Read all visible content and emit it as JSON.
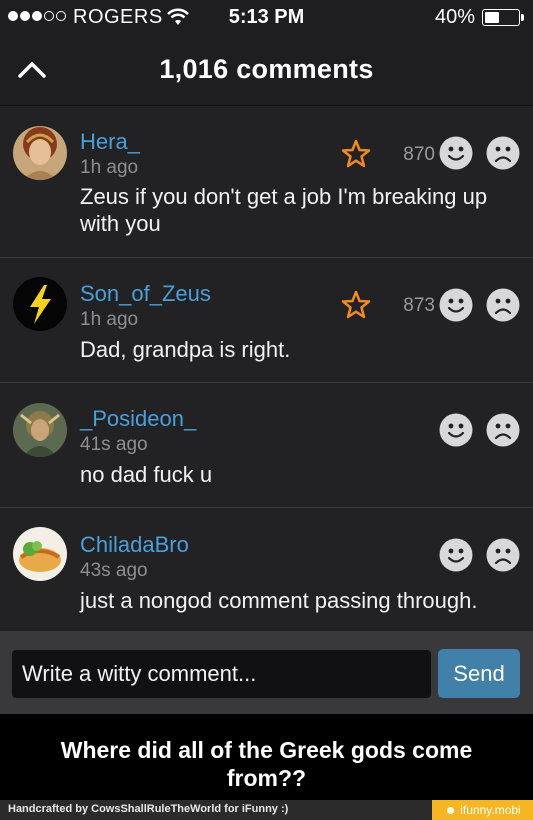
{
  "status_bar": {
    "carrier": "ROGERS",
    "time": "5:13 PM",
    "battery_pct": "40%",
    "battery_level": 0.4,
    "signal_bars_filled": 3,
    "signal_bars_total": 5
  },
  "header": {
    "title": "1,016 comments",
    "back_icon": "chevron-up-icon"
  },
  "comments": [
    {
      "username": "Hera_",
      "time": "1h ago",
      "text": "Zeus if you don't get a job I'm breaking up with you",
      "score": "870",
      "starred_icon": "star-outline-icon"
    },
    {
      "username": "Son_of_Zeus",
      "time": "1h ago",
      "text": "Dad, grandpa is right.",
      "score": "873",
      "starred_icon": "star-outline-icon"
    },
    {
      "username": "_Posideon_",
      "time": "41s ago",
      "text": "no dad fuck u",
      "score": ""
    },
    {
      "username": "ChiladaBro",
      "time": "43s ago",
      "text": "just a nongod comment passing through.",
      "score": ""
    }
  ],
  "composer": {
    "placeholder": "Write a witty comment...",
    "send_label": "Send"
  },
  "caption": "Where did all of the Greek gods come from??",
  "footer": {
    "credit": "Handcrafted by CowsShallRuleTheWorld for iFunny :)",
    "brand": "ifunny.mobi"
  },
  "colors": {
    "username": "#4a9fd8",
    "star": "#f08a24",
    "send_button": "#4180a8",
    "brand": "#f6b623"
  }
}
